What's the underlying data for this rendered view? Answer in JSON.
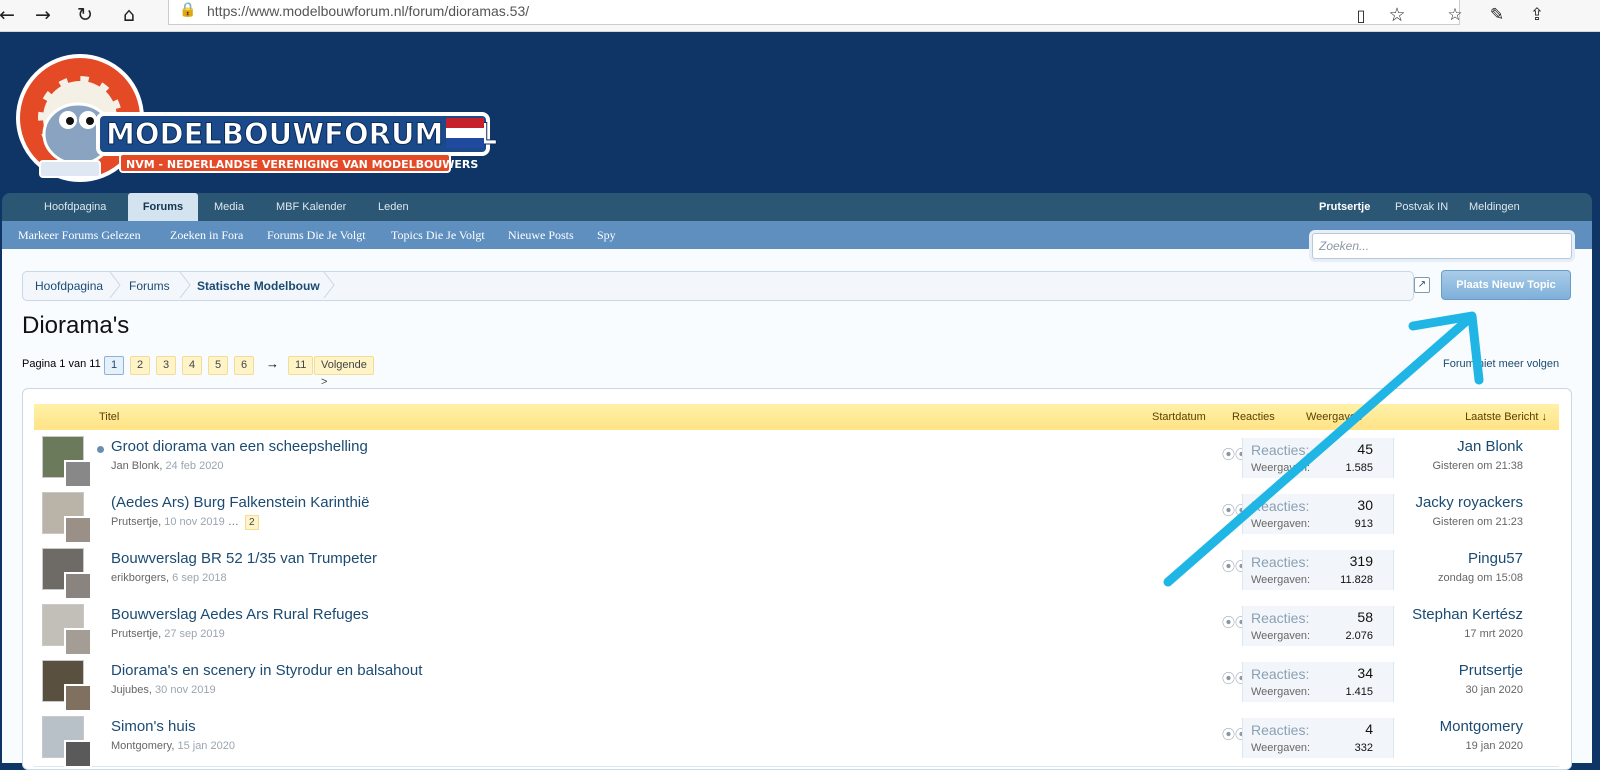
{
  "browser": {
    "url_host": "https://www.modelbouwforum.nl",
    "url_path": "/forum/dioramas.53/",
    "icons": [
      "back-icon",
      "forward-icon",
      "refresh-icon",
      "home-icon",
      "lock-icon",
      "reading-view-icon",
      "favorite-star-icon",
      "favorites-list-icon",
      "pen-icon",
      "share-icon"
    ]
  },
  "logo": {
    "wordmark": "MODELBOUWFORUM.NL",
    "tagline": "NVM - NEDERLANDSE VERENIGING VAN MODELBOUWERS"
  },
  "nav": {
    "tabs": [
      "Hoofdpagina",
      "Forums",
      "Media",
      "MBF Kalender",
      "Leden"
    ],
    "active_tab": "Forums",
    "user": "Prutsertje",
    "inbox": "Postvak IN",
    "alerts": "Meldingen"
  },
  "subnav": {
    "links": [
      "Markeer Forums Gelezen",
      "Zoeken in Fora",
      "Forums Die Je Volgt",
      "Topics Die Je Volgt",
      "Nieuwe Posts",
      "Spy"
    ]
  },
  "search": {
    "placeholder": "Zoeken..."
  },
  "breadcrumb": [
    "Hoofdpagina",
    "Forums",
    "Statische Modelbouw"
  ],
  "new_topic_button": "Plaats Nieuw Topic",
  "page_title": "Diorama's",
  "pagination": {
    "label": "Pagina 1 van 11",
    "pages": [
      "1",
      "2",
      "3",
      "4",
      "5",
      "6"
    ],
    "arrow": "→",
    "last": "11",
    "next": "Volgende >",
    "current": "1"
  },
  "unfollow_link": "Forum niet meer volgen",
  "columns": {
    "title": "Titel",
    "start_date": "Startdatum",
    "replies": "Reacties",
    "views": "Weergaven",
    "last_post": "Laatste Bericht ↓"
  },
  "threads": [
    {
      "title": "Groot diorama van een scheepshelling",
      "author": "Jan Blonk",
      "date": "24 feb 2020",
      "pages": [],
      "replies_label": "Reacties:",
      "replies": "45",
      "views_label": "Weergaven:",
      "views": "1.585",
      "last_user": "Jan Blonk",
      "last_time": "Gisteren om 21:38",
      "unread": true
    },
    {
      "title": "(Aedes Ars) Burg Falkenstein Karinthië",
      "author": "Prutsertje",
      "date": "10 nov 2019",
      "pages": [
        "2"
      ],
      "replies_label": "Reacties:",
      "replies": "30",
      "views_label": "Weergaven:",
      "views": "913",
      "last_user": "Jacky royackers",
      "last_time": "Gisteren om 21:23",
      "unread": false
    },
    {
      "title": "Bouwverslag BR 52 1/35 van Trumpeter",
      "author": "erikborgers",
      "date": "6 sep 2018",
      "pages": [],
      "replies_label": "Reacties:",
      "replies": "319",
      "views_label": "Weergaven:",
      "views": "11.828",
      "last_user": "Pingu57",
      "last_time": "zondag om 15:08",
      "unread": false
    },
    {
      "title": "Bouwverslag Aedes Ars Rural Refuges",
      "author": "Prutsertje",
      "date": "27 sep 2019",
      "pages": [],
      "replies_label": "Reacties:",
      "replies": "58",
      "views_label": "Weergaven:",
      "views": "2.076",
      "last_user": "Stephan Kertész",
      "last_time": "17 mrt 2020",
      "unread": false
    },
    {
      "title": "Diorama's en scenery in Styrodur en balsahout",
      "author": "Jujubes",
      "date": "30 nov 2019",
      "pages": [],
      "replies_label": "Reacties:",
      "replies": "34",
      "views_label": "Weergaven:",
      "views": "1.415",
      "last_user": "Prutsertje",
      "last_time": "30 jan 2020",
      "unread": false
    },
    {
      "title": "Simon's huis",
      "author": "Montgomery",
      "date": "15 jan 2020",
      "pages": [],
      "replies_label": "Reacties:",
      "replies": "4",
      "views_label": "Weergaven:",
      "views": "332",
      "last_user": "Montgomery",
      "last_time": "19 jan 2020",
      "unread": false
    }
  ],
  "colors": {
    "header_bg": "#0f3566",
    "nav_bg": "#2b5674",
    "subnav_bg": "#5e8fbf",
    "list_header": "#ffe386",
    "link": "#1b4b72",
    "annotation_arrow": "#1fb6e6"
  }
}
